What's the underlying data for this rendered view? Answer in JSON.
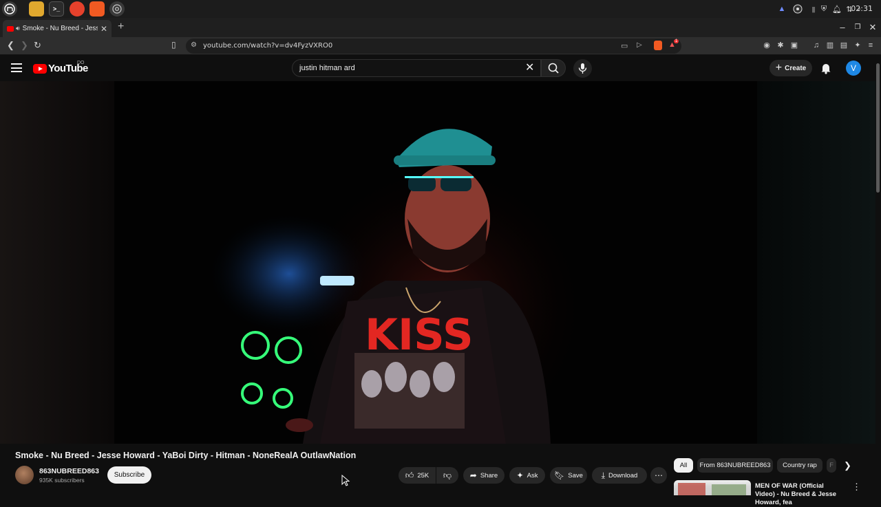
{
  "os": {
    "taskbar_apps": [
      "mint-menu-icon",
      "files-icon",
      "terminal-icon",
      "firefox-icon",
      "brave-icon",
      "chromium-icon"
    ],
    "clock": "02:31"
  },
  "browser": {
    "tab_title": "Smoke - Nu Breed - Jesse H",
    "url": "youtube.com/watch?v=dv4FyzVXRO0",
    "extension_badge": "1"
  },
  "youtube": {
    "logo_text": "YouTube",
    "country_code": "DO",
    "search_query": "justin hitman ard",
    "create_label": "Create",
    "avatar_letter": "V"
  },
  "video": {
    "title": "Smoke - Nu Breed - Jesse Howard - YaBoi Dirty - Hitman - NoneRealA OutlawNation",
    "shirt_text": "KISS",
    "channel_name": "863NUBREED863",
    "subscribers": "935K subscribers",
    "subscribe_label": "Subscribe",
    "like_count": "25K",
    "share_label": "Share",
    "ask_label": "Ask",
    "save_label": "Save",
    "download_label": "Download"
  },
  "related": {
    "chips": [
      "All",
      "From 863NUBREED863",
      "Country rap",
      "F"
    ],
    "first_title": "MEN OF WAR (Official Video) - Nu Breed & Jesse Howard, fea"
  },
  "colors": {
    "youtube_red": "#ff0000",
    "background": "#0f0f0f",
    "avatar_blue": "#1e88e5"
  }
}
